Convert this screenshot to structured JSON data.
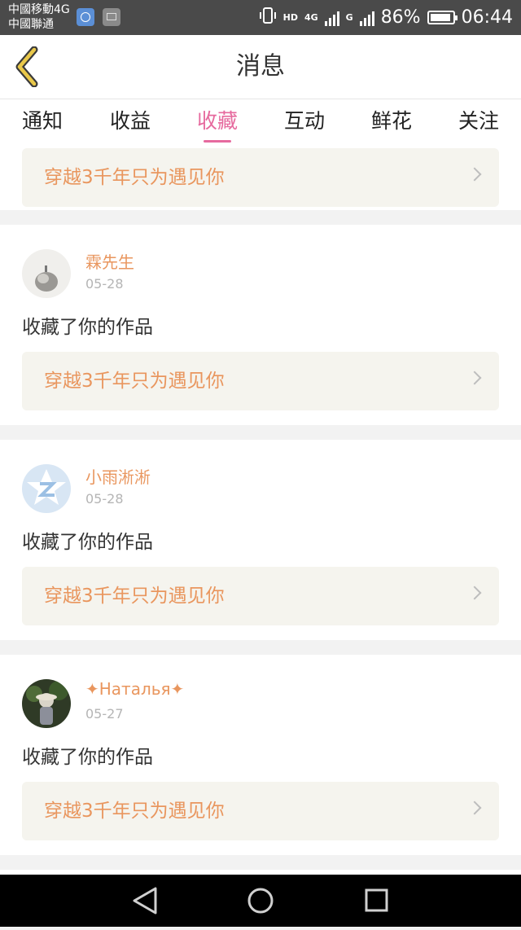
{
  "status_bar": {
    "carrier_1": "中國移動4G",
    "carrier_2": "中國聯通",
    "hd": "HD",
    "net_1": "4G",
    "net_2": "G",
    "battery_percent": "86%",
    "time": "06:44"
  },
  "header": {
    "title": "消息"
  },
  "tabs": [
    {
      "label": "通知",
      "active": false
    },
    {
      "label": "收益",
      "active": false
    },
    {
      "label": "收藏",
      "active": true
    },
    {
      "label": "互动",
      "active": false
    },
    {
      "label": "鲜花",
      "active": false
    },
    {
      "label": "关注",
      "active": false
    }
  ],
  "feed": {
    "partial_item": {
      "work_title": "穿越3千年只为遇见你"
    },
    "items": [
      {
        "username": "霖先生",
        "date": "05-28",
        "action": "收藏了你的作品",
        "work_title": "穿越3千年只为遇见你"
      },
      {
        "username": "小雨淅淅",
        "date": "05-28",
        "action": "收藏了你的作品",
        "work_title": "穿越3千年只为遇见你"
      },
      {
        "username": "✦Наталья✦",
        "date": "05-27",
        "action": "收藏了你的作品",
        "work_title": "穿越3千年只为遇见你"
      }
    ]
  },
  "colors": {
    "accent_pink": "#e66a9e",
    "username_orange": "#e9965e",
    "work_box_bg": "#f5f4ee"
  },
  "nav_bar": {
    "icons": [
      "back-triangle-icon",
      "home-circle-icon",
      "recents-square-icon"
    ]
  }
}
